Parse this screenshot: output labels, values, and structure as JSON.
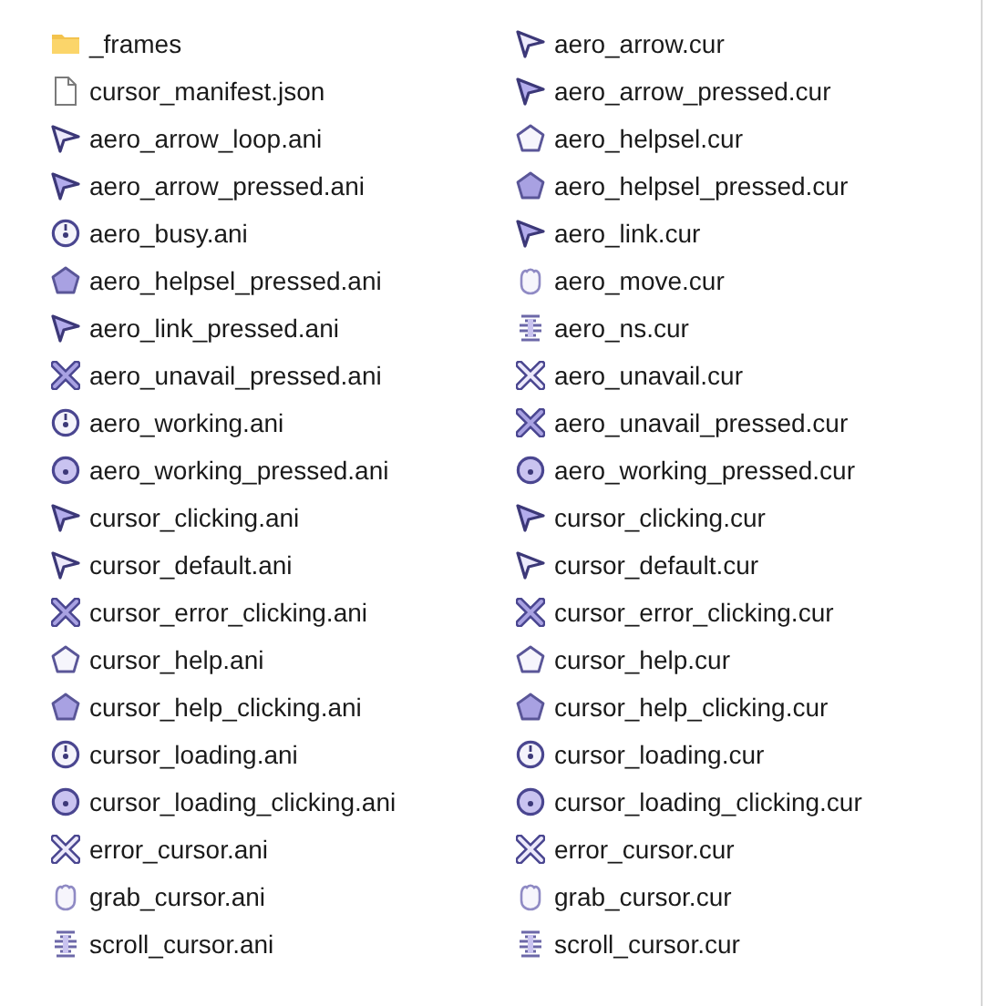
{
  "columns": [
    [
      {
        "name": "_frames",
        "kind": "folder"
      },
      {
        "name": "cursor_manifest.json",
        "kind": "document"
      },
      {
        "name": "aero_arrow_loop.ani",
        "kind": "arrow"
      },
      {
        "name": "aero_arrow_pressed.ani",
        "kind": "arrow-pressed"
      },
      {
        "name": "aero_busy.ani",
        "kind": "busy"
      },
      {
        "name": "aero_helpsel_pressed.ani",
        "kind": "help-pressed"
      },
      {
        "name": "aero_link_pressed.ani",
        "kind": "arrow-pressed"
      },
      {
        "name": "aero_unavail_pressed.ani",
        "kind": "unavail-pressed"
      },
      {
        "name": "aero_working.ani",
        "kind": "busy"
      },
      {
        "name": "aero_working_pressed.ani",
        "kind": "busy-pressed"
      },
      {
        "name": "cursor_clicking.ani",
        "kind": "arrow-pressed"
      },
      {
        "name": "cursor_default.ani",
        "kind": "arrow"
      },
      {
        "name": "cursor_error_clicking.ani",
        "kind": "unavail-pressed"
      },
      {
        "name": "cursor_help.ani",
        "kind": "help"
      },
      {
        "name": "cursor_help_clicking.ani",
        "kind": "help-pressed"
      },
      {
        "name": "cursor_loading.ani",
        "kind": "busy"
      },
      {
        "name": "cursor_loading_clicking.ani",
        "kind": "busy-pressed"
      },
      {
        "name": "error_cursor.ani",
        "kind": "unavail"
      },
      {
        "name": "grab_cursor.ani",
        "kind": "hand"
      },
      {
        "name": "scroll_cursor.ani",
        "kind": "scroll"
      }
    ],
    [
      {
        "name": "aero_arrow.cur",
        "kind": "arrow"
      },
      {
        "name": "aero_arrow_pressed.cur",
        "kind": "arrow-pressed"
      },
      {
        "name": "aero_helpsel.cur",
        "kind": "help"
      },
      {
        "name": "aero_helpsel_pressed.cur",
        "kind": "help-pressed"
      },
      {
        "name": "aero_link.cur",
        "kind": "arrow-pressed"
      },
      {
        "name": "aero_move.cur",
        "kind": "hand"
      },
      {
        "name": "aero_ns.cur",
        "kind": "scroll"
      },
      {
        "name": "aero_unavail.cur",
        "kind": "unavail"
      },
      {
        "name": "aero_unavail_pressed.cur",
        "kind": "unavail-pressed"
      },
      {
        "name": "aero_working_pressed.cur",
        "kind": "busy-pressed"
      },
      {
        "name": "cursor_clicking.cur",
        "kind": "arrow-pressed"
      },
      {
        "name": "cursor_default.cur",
        "kind": "arrow"
      },
      {
        "name": "cursor_error_clicking.cur",
        "kind": "unavail-pressed"
      },
      {
        "name": "cursor_help.cur",
        "kind": "help"
      },
      {
        "name": "cursor_help_clicking.cur",
        "kind": "help-pressed"
      },
      {
        "name": "cursor_loading.cur",
        "kind": "busy"
      },
      {
        "name": "cursor_loading_clicking.cur",
        "kind": "busy-pressed"
      },
      {
        "name": "error_cursor.cur",
        "kind": "unavail"
      },
      {
        "name": "grab_cursor.cur",
        "kind": "hand"
      },
      {
        "name": "scroll_cursor.cur",
        "kind": "scroll"
      }
    ]
  ]
}
